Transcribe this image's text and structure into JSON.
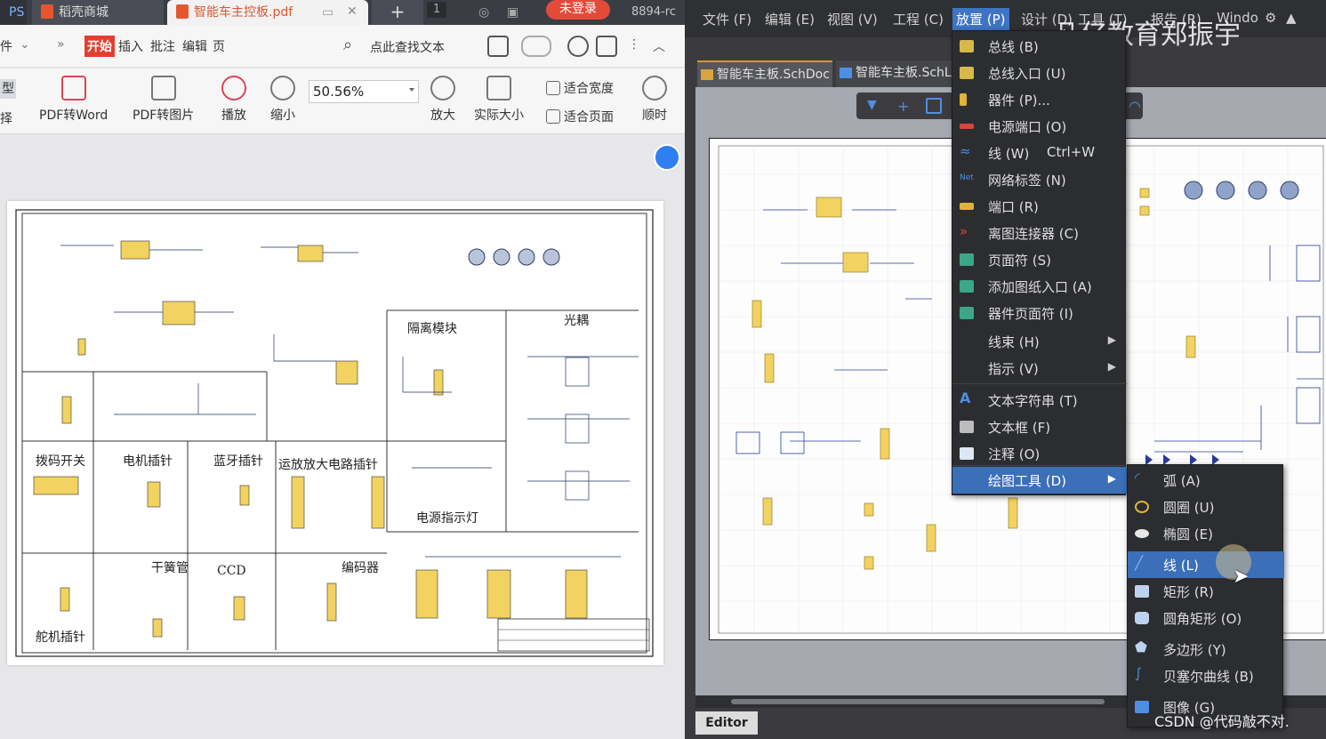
{
  "pdf_window": {
    "tabs": {
      "ps": "PS",
      "daoke": "稻壳商城",
      "pdf": "智能车主控板.pdf",
      "add": "+",
      "count": "1",
      "login": "未登录",
      "version": "8894-rc"
    },
    "menu": {
      "file": "件",
      "more": "»",
      "start": "开始",
      "insert": "插入",
      "comment": "批注",
      "edit": "编辑",
      "page": "页",
      "search_placeholder": "点此查找文本"
    },
    "toolbar": {
      "model": "型",
      "select": "择",
      "pdf_to_word": "PDF转Word",
      "pdf_to_image": "PDF转图片",
      "play": "播放",
      "zoom_out": "缩小",
      "zoom_value": "50.56%",
      "zoom_in": "放大",
      "actual_size": "实际大小",
      "fit_width": "适合宽度",
      "fit_page": "适合页面",
      "clockwise": "顺时"
    },
    "schematic_modules": [
      "隔离模块",
      "光耦",
      "拨码开关",
      "电机插针",
      "蓝牙插针",
      "运放放大电路插针",
      "电源指示灯",
      "干簧管",
      "CCD",
      "编码器",
      "舵机插针"
    ]
  },
  "altium": {
    "menubar": [
      "文件 (F)",
      "编辑 (E)",
      "视图 (V)",
      "工程 (C)",
      "放置 (P)",
      "设计 (D)",
      "工具 (T)",
      "报告 (R)",
      "Windo"
    ],
    "watermark": "凡亿教育郑振宇",
    "doc_tabs": [
      "智能车主板.SchDoc",
      "智能车主板.SchL"
    ],
    "place_menu": [
      {
        "label": "总线 (B)",
        "icon": "bus-icon",
        "color": "#d9b84a"
      },
      {
        "label": "总线入口 (U)",
        "icon": "bus-entry-icon",
        "color": "#d9b84a"
      },
      {
        "label": "器件 (P)...",
        "icon": "part-icon",
        "color": "#e0b338"
      },
      {
        "label": "电源端口 (O)",
        "icon": "power-port-icon",
        "color": "#d9463b"
      },
      {
        "label": "线 (W)",
        "shortcut": "Ctrl+W",
        "icon": "wire-icon",
        "color": "#4e8fe0"
      },
      {
        "label": "网络标签 (N)",
        "icon": "net-label-icon",
        "color": "#4e8fe0"
      },
      {
        "label": "端口 (R)",
        "icon": "port-icon",
        "color": "#e0b338"
      },
      {
        "label": "离图连接器 (C)",
        "icon": "off-sheet-connector-icon",
        "color": "#d9463b"
      },
      {
        "label": "页面符 (S)",
        "icon": "sheet-symbol-icon",
        "color": "#3aa78a"
      },
      {
        "label": "添加图纸入口 (A)",
        "icon": "sheet-entry-icon",
        "color": "#3aa78a"
      },
      {
        "label": "器件页面符 (I)",
        "icon": "device-sheet-icon",
        "color": "#3aa78a"
      },
      {
        "label": "线束 (H)",
        "icon": "harness-icon",
        "color": "#2c2d30",
        "submenu": true
      },
      {
        "label": "指示 (V)",
        "icon": "directive-icon",
        "color": "#2c2d30",
        "submenu": true
      },
      {
        "label": "文本字符串 (T)",
        "icon": "text-string-icon",
        "color": "#4e8fe0"
      },
      {
        "label": "文本框 (F)",
        "icon": "text-frame-icon",
        "color": "#bcbcbc"
      },
      {
        "label": "注释 (O)",
        "icon": "note-icon",
        "color": "#4e8fe0"
      },
      {
        "label": "绘图工具 (D)",
        "icon": "drawing-tools-icon",
        "color": "#2c2d30",
        "submenu": true,
        "highlighted": true
      }
    ],
    "drawing_submenu": [
      {
        "label": "弧 (A)",
        "icon": "arc-icon",
        "color": "#4e8fe0"
      },
      {
        "label": "圆圈 (U)",
        "icon": "circle-icon",
        "color": "#e0b338"
      },
      {
        "label": "椭圆 (E)",
        "icon": "ellipse-icon",
        "color": "#e8e8e8"
      },
      {
        "label": "线 (L)",
        "icon": "line-icon",
        "color": "#4e8fe0",
        "highlighted": true
      },
      {
        "label": "矩形 (R)",
        "icon": "rectangle-icon",
        "color": "#bcd3f0"
      },
      {
        "label": "圆角矩形 (O)",
        "icon": "round-rectangle-icon",
        "color": "#bcd3f0"
      },
      {
        "label": "多边形 (Y)",
        "icon": "polygon-icon",
        "color": "#bcd3f0"
      },
      {
        "label": "贝塞尔曲线 (B)",
        "icon": "bezier-icon",
        "color": "#4e8fe0"
      },
      {
        "label": "图像 (G)",
        "icon": "image-icon",
        "color": "#4e8fe0"
      }
    ],
    "editor_tab": "Editor",
    "csdn_watermark": "CSDN @代码敲不对."
  }
}
